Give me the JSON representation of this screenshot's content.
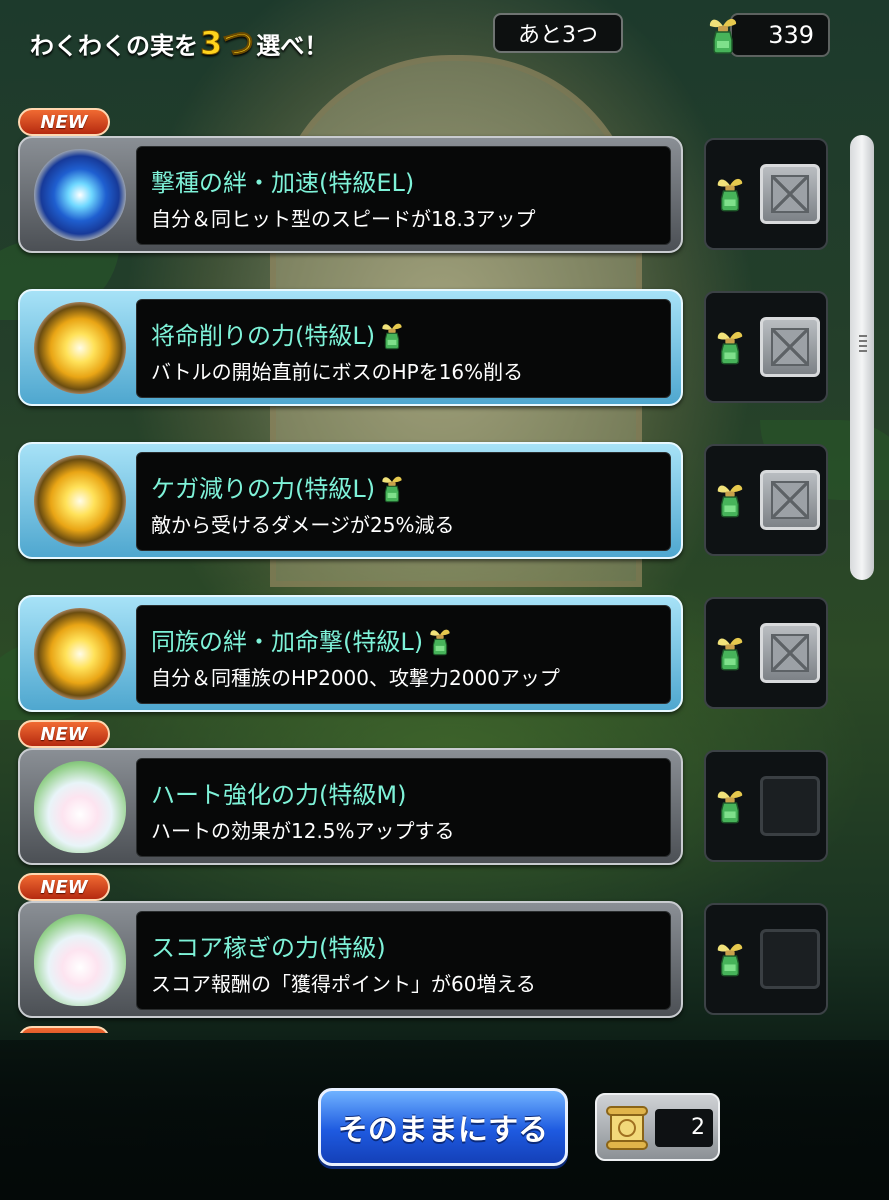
{
  "header": {
    "title_prefix": "わくわくの実を",
    "title_count": "3つ",
    "title_suffix": "選べ！",
    "remaining": "あと3つ",
    "currency_value": "339"
  },
  "badge_new_label": "NEW",
  "skills": [
    {
      "name": "撃種の絆・加速(特級EL)",
      "desc": "自分＆同ヒット型のスピードが18.3アップ",
      "is_new": true,
      "locked": true,
      "icon": "blue-flower-orb-icon",
      "frame": "silver"
    },
    {
      "name": "将命削りの力(特級L)",
      "desc": "バトルの開始直前にボスのHPを16%削る",
      "is_new": false,
      "locked": true,
      "icon": "golden-sun-orb-icon",
      "frame": "blue",
      "has_bottle": true
    },
    {
      "name": "ケガ減りの力(特級L)",
      "desc": "敵から受けるダメージが25%減る",
      "is_new": false,
      "locked": true,
      "icon": "golden-sun-orb-icon",
      "frame": "blue",
      "has_bottle": true
    },
    {
      "name": "同族の絆・加命撃(特級L)",
      "desc": "自分＆同種族のHP2000、攻撃力2000アップ",
      "is_new": false,
      "locked": true,
      "icon": "golden-sun-orb-icon",
      "frame": "blue",
      "has_bottle": true
    },
    {
      "name": "ハート強化の力(特級M)",
      "desc": "ハートの効果が12.5%アップする",
      "is_new": true,
      "locked": false,
      "icon": "lotus-bud-icon",
      "frame": "silver"
    },
    {
      "name": "スコア稼ぎの力(特級)",
      "desc": "スコア報酬の「獲得ポイント」が60増える",
      "is_new": true,
      "locked": false,
      "icon": "lotus-bud-icon",
      "frame": "silver"
    }
  ],
  "footer": {
    "keep_button": "そのままにする",
    "ticket_count": "2"
  },
  "colors": {
    "skill_name": "#7ef2d8",
    "title_count": "#ffd21c",
    "new_badge": "#d8401c",
    "keep_button": "#1e5ae0"
  }
}
